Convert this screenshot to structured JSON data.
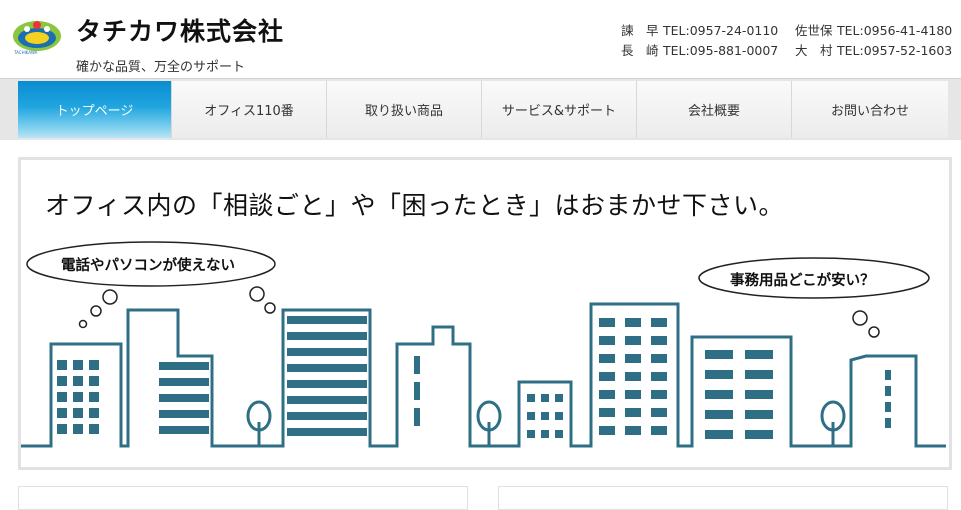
{
  "header": {
    "company_name": "タチカワ株式会社",
    "logo_text": "TACHIKAWA",
    "tagline": "確かな品質、万全のサポート",
    "tels": [
      {
        "place": "諫　早",
        "number": "TEL:0957-24-0110"
      },
      {
        "place": "佐世保",
        "number": "TEL:0956-41-4180"
      },
      {
        "place": "長　崎",
        "number": "TEL:095-881-0007"
      },
      {
        "place": "大　村",
        "number": "TEL:0957-52-1603"
      }
    ]
  },
  "nav": {
    "items": [
      {
        "label": "トップページ"
      },
      {
        "label": "オフィス110番"
      },
      {
        "label": "取り扱い商品"
      },
      {
        "label": "サービス&サポート"
      },
      {
        "label": "会社概要"
      },
      {
        "label": "お問い合わせ"
      }
    ]
  },
  "hero": {
    "title": "オフィス内の「相談ごと」や「困ったとき」はおまかせ下さい。",
    "bubble_left": "電話やパソコンが使えない",
    "bubble_right": "事務用品どこが安い？"
  },
  "colors": {
    "building": "#2f6f86",
    "nav_active": "#1a9ad6",
    "logo_green": "#8cc63f",
    "logo_blue": "#1a6fb3"
  }
}
